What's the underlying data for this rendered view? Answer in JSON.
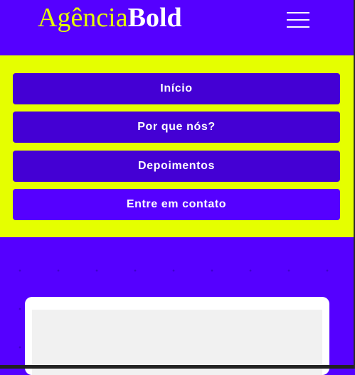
{
  "header": {
    "logo_light": "Agência",
    "logo_bold": "Bold",
    "menu_icon": "hamburger-menu-icon"
  },
  "nav": {
    "items": [
      {
        "label": "Início"
      },
      {
        "label": "Por que nós?"
      },
      {
        "label": "Depoimentos"
      },
      {
        "label": "Entre em contato"
      }
    ]
  },
  "colors": {
    "brand_purple": "#5500ff",
    "nav_button": "#4400d4",
    "accent_yellow": "#e5ff00",
    "text_white": "#ffffff"
  }
}
